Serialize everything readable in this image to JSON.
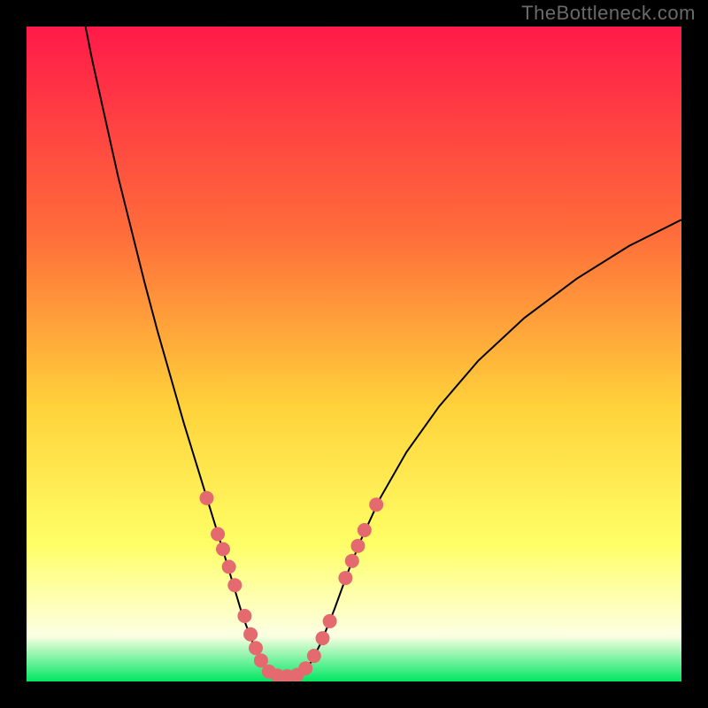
{
  "watermark": "TheBottleneck.com",
  "chart_data": {
    "type": "line",
    "title": "",
    "xlabel": "",
    "ylabel": "",
    "xlim": [
      0,
      100
    ],
    "ylim": [
      0,
      100
    ],
    "grid": false,
    "legend": false,
    "gradient_colors": {
      "top": "#ff1a49",
      "mid1": "#ff6e3a",
      "mid2": "#ffd23a",
      "mid3": "#ffff66",
      "mid4": "#fdffe3",
      "bottom": "#00e763"
    },
    "series": [
      {
        "name": "bottleneck-curve",
        "stroke": "#000000",
        "stroke_width": 2,
        "points": [
          {
            "x": 9.0,
            "y": 100.0
          },
          {
            "x": 10.0,
            "y": 95.0
          },
          {
            "x": 12.0,
            "y": 86.0
          },
          {
            "x": 14.0,
            "y": 77.0
          },
          {
            "x": 16.0,
            "y": 69.0
          },
          {
            "x": 18.0,
            "y": 61.0
          },
          {
            "x": 20.0,
            "y": 53.5
          },
          {
            "x": 22.0,
            "y": 46.5
          },
          {
            "x": 24.0,
            "y": 39.5
          },
          {
            "x": 26.0,
            "y": 33.0
          },
          {
            "x": 28.0,
            "y": 26.5
          },
          {
            "x": 30.0,
            "y": 20.0
          },
          {
            "x": 31.5,
            "y": 15.0
          },
          {
            "x": 33.0,
            "y": 10.0
          },
          {
            "x": 34.5,
            "y": 6.0
          },
          {
            "x": 36.0,
            "y": 3.0
          },
          {
            "x": 37.5,
            "y": 1.4
          },
          {
            "x": 39.0,
            "y": 0.8
          },
          {
            "x": 40.5,
            "y": 0.8
          },
          {
            "x": 42.0,
            "y": 1.4
          },
          {
            "x": 43.5,
            "y": 3.0
          },
          {
            "x": 45.0,
            "y": 6.0
          },
          {
            "x": 47.0,
            "y": 11.0
          },
          {
            "x": 49.0,
            "y": 16.5
          },
          {
            "x": 51.0,
            "y": 21.5
          },
          {
            "x": 54.0,
            "y": 28.0
          },
          {
            "x": 58.0,
            "y": 35.0
          },
          {
            "x": 63.0,
            "y": 42.0
          },
          {
            "x": 69.0,
            "y": 49.0
          },
          {
            "x": 76.0,
            "y": 55.5
          },
          {
            "x": 84.0,
            "y": 61.5
          },
          {
            "x": 92.0,
            "y": 66.5
          },
          {
            "x": 100.0,
            "y": 70.5
          }
        ]
      },
      {
        "name": "datapoint-markers",
        "stroke": "#e46a6f",
        "marker_radius": 8,
        "points": [
          {
            "x": 27.5,
            "y": 28.0
          },
          {
            "x": 29.2,
            "y": 22.5
          },
          {
            "x": 30.0,
            "y": 20.2
          },
          {
            "x": 30.9,
            "y": 17.5
          },
          {
            "x": 31.8,
            "y": 14.7
          },
          {
            "x": 33.3,
            "y": 10.0
          },
          {
            "x": 34.2,
            "y": 7.2
          },
          {
            "x": 35.0,
            "y": 5.1
          },
          {
            "x": 35.8,
            "y": 3.2
          },
          {
            "x": 37.0,
            "y": 1.5
          },
          {
            "x": 38.3,
            "y": 0.9
          },
          {
            "x": 39.8,
            "y": 0.8
          },
          {
            "x": 41.3,
            "y": 1.0
          },
          {
            "x": 42.6,
            "y": 2.0
          },
          {
            "x": 43.9,
            "y": 3.9
          },
          {
            "x": 45.2,
            "y": 6.6
          },
          {
            "x": 46.3,
            "y": 9.2
          },
          {
            "x": 48.7,
            "y": 15.8
          },
          {
            "x": 49.7,
            "y": 18.4
          },
          {
            "x": 50.6,
            "y": 20.7
          },
          {
            "x": 51.6,
            "y": 23.1
          },
          {
            "x": 53.4,
            "y": 27.0
          }
        ]
      }
    ]
  }
}
